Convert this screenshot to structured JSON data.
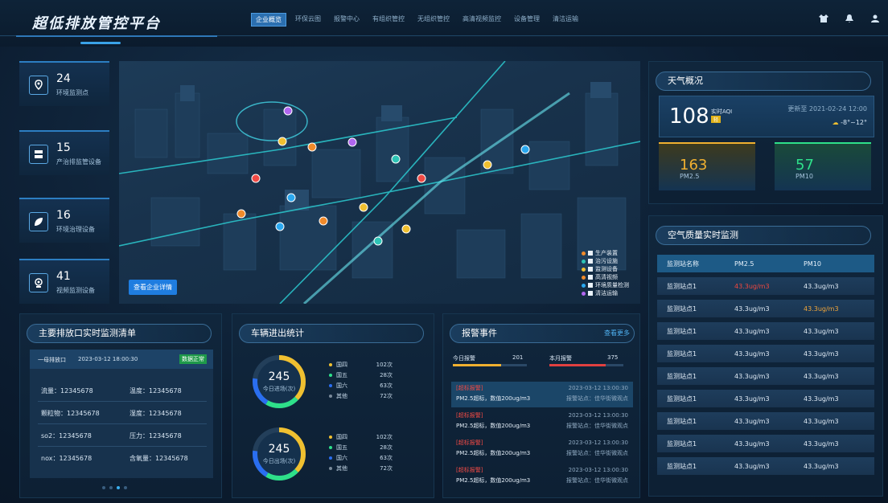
{
  "header": {
    "title": "超低排放管控平台",
    "nav": [
      "企业概览",
      "环保云图",
      "报警中心",
      "有组织管控",
      "无组织管控",
      "高清视频监控",
      "设备管理",
      "清洁运输"
    ],
    "active_nav": "企业概览",
    "icons": [
      "shirt-icon",
      "bell-icon",
      "user-icon"
    ]
  },
  "stats": [
    {
      "value": "24",
      "label": "环境监测点",
      "icon": "location-pin-icon"
    },
    {
      "value": "15",
      "label": "产治排监管设备",
      "icon": "server-icon"
    },
    {
      "value": "16",
      "label": "环境治理设备",
      "icon": "leaf-icon"
    },
    {
      "value": "41",
      "label": "视频监测设备",
      "icon": "camera-icon"
    }
  ],
  "map": {
    "button": "查看企业详情",
    "legend": [
      {
        "label": "生产装置",
        "color": "#f08a2a"
      },
      {
        "label": "治污设施",
        "color": "#2ec4b6"
      },
      {
        "label": "监测设备",
        "color": "#f0c030"
      },
      {
        "label": "高清视频",
        "color": "#f08a2a"
      },
      {
        "label": "环境质量检测",
        "color": "#2aa8f0"
      },
      {
        "label": "清洁运输",
        "color": "#b066f0"
      }
    ]
  },
  "weather": {
    "title": "天气概况",
    "aqi": "108",
    "aqi_label": "实时AQI",
    "aqi_badge": "轻",
    "update": "更新至 2021-02-24 12:00",
    "temp": "-8°~12°",
    "pm25": "163",
    "pm25_label": "PM2.5",
    "pm10": "57",
    "pm10_label": "PM10",
    "colors": {
      "pm25": "#f0b030",
      "pm10": "#2ee08a"
    }
  },
  "air": {
    "title": "空气质量实时监测",
    "headers": [
      "监测站名称",
      "PM2.5",
      "PM10"
    ],
    "rows": [
      [
        "监测站点1",
        "43.3ug/m3",
        "43.3ug/m3"
      ],
      [
        "监测站点1",
        "43.3ug/m3",
        "43.3ug/m3"
      ],
      [
        "监测站点1",
        "43.3ug/m3",
        "43.3ug/m3"
      ],
      [
        "监测站点1",
        "43.3ug/m3",
        "43.3ug/m3"
      ],
      [
        "监测站点1",
        "43.3ug/m3",
        "43.3ug/m3"
      ],
      [
        "监测站点1",
        "43.3ug/m3",
        "43.3ug/m3"
      ],
      [
        "监测站点1",
        "43.3ug/m3",
        "43.3ug/m3"
      ],
      [
        "监测站点1",
        "43.3ug/m3",
        "43.3ug/m3"
      ],
      [
        "监测站点1",
        "43.3ug/m3",
        "43.3ug/m3"
      ]
    ]
  },
  "discharge": {
    "title": "主要排放口实时监测清单",
    "name": "一母排放口",
    "time": "2023-03-12 18:00:30",
    "status": "数据正常",
    "items": [
      {
        "label": "流量：12345678"
      },
      {
        "label": "温度：12345678"
      },
      {
        "label": "颗粒物：12345678"
      },
      {
        "label": "湿度：12345678"
      },
      {
        "label": "so2：12345678"
      },
      {
        "label": "压力：12345678"
      },
      {
        "label": "nox：12345678"
      },
      {
        "label": "含氧量：12345678"
      }
    ]
  },
  "vehicle": {
    "title": "车辆进出统计",
    "in_value": "245",
    "in_label": "今日进场(次)",
    "out_value": "245",
    "out_label": "今日出场(次)",
    "rows": [
      {
        "name": "国四",
        "value": "102次",
        "color": "#f0c030"
      },
      {
        "name": "国五",
        "value": "28次",
        "color": "#2ee08a"
      },
      {
        "name": "国六",
        "value": "63次",
        "color": "#2a6ef0"
      },
      {
        "name": "其他",
        "value": "72次",
        "color": "#7a8a9a"
      }
    ]
  },
  "alarm": {
    "title": "报警事件",
    "more": "查看更多",
    "today_label": "今日报警",
    "today_value": "201",
    "month_label": "本月报警",
    "month_value": "375",
    "items": [
      {
        "tag": "[超标报警]",
        "msg": "PM2.5超标，数值200ug/m3",
        "time": "2023-03-12 13:00:30",
        "site": "报警站点：佳华街微观点"
      },
      {
        "tag": "[超标报警]",
        "msg": "PM2.5超标，数值200ug/m3",
        "time": "2023-03-12 13:00:30",
        "site": "报警站点：佳华街微观点"
      },
      {
        "tag": "[超标报警]",
        "msg": "PM2.5超标，数值200ug/m3",
        "time": "2023-03-12 13:00:30",
        "site": "报警站点：佳华街微观点"
      },
      {
        "tag": "[超标报警]",
        "msg": "PM2.5超标，数值200ug/m3",
        "time": "2023-03-12 13:00:30",
        "site": "报警站点：佳华街微观点"
      }
    ]
  }
}
